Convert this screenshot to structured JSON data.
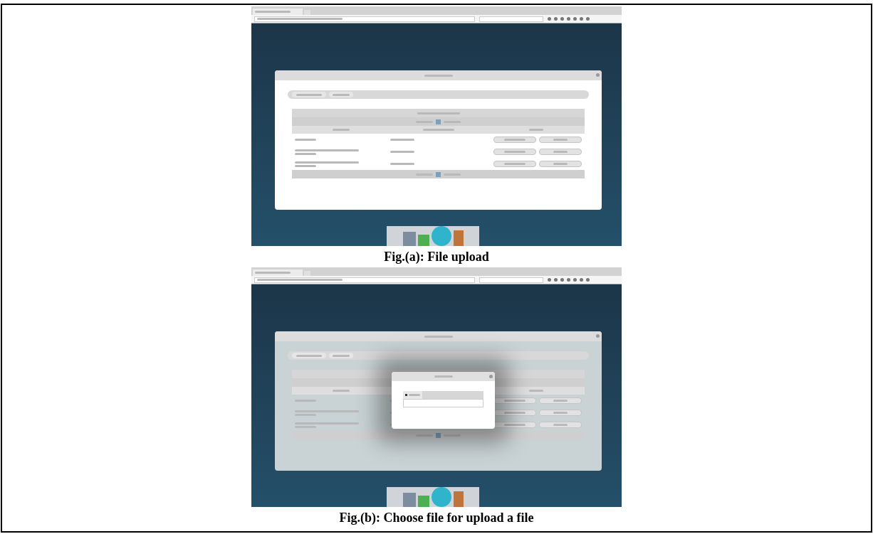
{
  "figures": [
    {
      "caption": "Fig.(a): File upload",
      "dialog_open": false,
      "rows": [
        {
          "kind": "single_line"
        },
        {
          "kind": "double_line"
        },
        {
          "kind": "double_line"
        }
      ]
    },
    {
      "caption": "Fig.(b): Choose file for upload a file",
      "dialog_open": true,
      "rows": [
        {
          "kind": "single_line"
        },
        {
          "kind": "double_line"
        },
        {
          "kind": "double_line"
        }
      ]
    }
  ]
}
